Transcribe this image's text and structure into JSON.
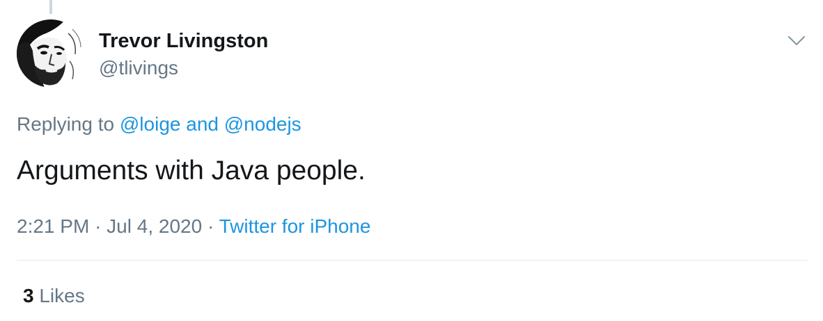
{
  "author": {
    "display_name": "Trevor Livingston",
    "handle": "@tlivings",
    "avatar_icon": "user-avatar"
  },
  "menu": {
    "icon": "chevron-down-icon"
  },
  "reply_context": {
    "prefix": "Replying to",
    "mention_1": "@loige",
    "conjunction": "and",
    "mention_2": "@nodejs"
  },
  "tweet": {
    "text": "Arguments with Java people."
  },
  "meta": {
    "time": "2:21 PM",
    "separator": "·",
    "date": "Jul 4, 2020",
    "source": "Twitter for iPhone"
  },
  "stats": {
    "likes_count": "3",
    "likes_label": "Likes"
  },
  "colors": {
    "text_primary": "#14171a",
    "text_secondary": "#657786",
    "link": "#1b95e0",
    "divider": "#e1e8ed"
  }
}
